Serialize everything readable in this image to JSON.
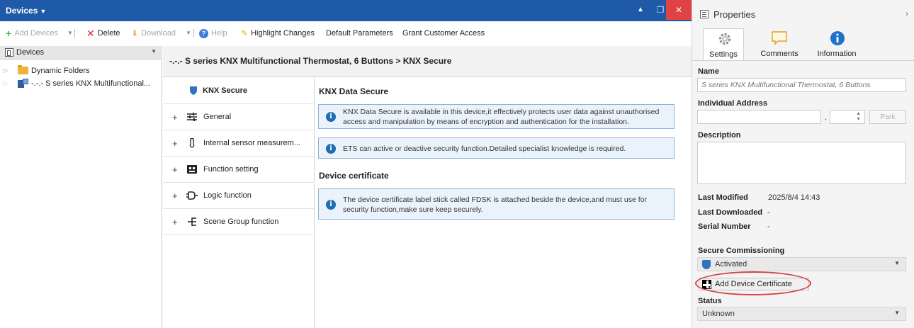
{
  "window": {
    "title": "Devices"
  },
  "toolbar": {
    "add_devices": "Add Devices",
    "delete": "Delete",
    "download": "Download",
    "help": "Help",
    "highlight_changes": "Highlight Changes",
    "default_parameters": "Default Parameters",
    "grant_customer_access": "Grant Customer Access"
  },
  "tree": {
    "header": "Devices",
    "items": [
      {
        "label": "Dynamic Folders",
        "icon": "folder-icon"
      },
      {
        "label": "-.-.- S series KNX Multifunctional...",
        "icon": "device-icon"
      }
    ]
  },
  "breadcrumb": "-.-.- S series KNX Multifunctional Thermostat, 6 Buttons > KNX Secure",
  "param_tree": [
    {
      "label": "KNX Secure",
      "icon": "shield-icon",
      "selected": true
    },
    {
      "label": "General",
      "icon": "sliders-icon"
    },
    {
      "label": "Internal sensor measurem...",
      "icon": "sensor-icon"
    },
    {
      "label": "Function setting",
      "icon": "function-icon"
    },
    {
      "label": "Logic function",
      "icon": "logic-icon"
    },
    {
      "label": "Scene Group function",
      "icon": "scene-icon"
    }
  ],
  "pane": {
    "section1": "KNX Data Secure",
    "info1": "KNX Data Secure is available in this device,it effectively protects user data against unauthorised access and manipulation by means of encryption and authentication for the installation.",
    "info2": "ETS can active or deactive security function.Detailed specialist knowledge is required.",
    "section2": "Device certificate",
    "info3": "The device certificate label stick called FDSK is attached beside the device,and must use for security function,make sure keep securely."
  },
  "properties": {
    "title": "Properties",
    "tabs": [
      "Settings",
      "Comments",
      "Information"
    ],
    "name_label": "Name",
    "name_value": "S series KNX Multifunctional Thermostat, 6 Buttons",
    "address_label": "Individual Address",
    "park_label": "Park",
    "description_label": "Description",
    "last_modified_label": "Last Modified",
    "last_modified_value": "2025/8/4 14:43",
    "last_downloaded_label": "Last Downloaded",
    "last_downloaded_value": "-",
    "serial_label": "Serial Number",
    "serial_value": "-",
    "secure_label": "Secure Commissioning",
    "secure_value": "Activated",
    "add_cert": "Add Device Certificate",
    "status_label": "Status",
    "status_value": "Unknown"
  },
  "colors": {
    "titlebar": "#1f5aa8",
    "close": "#e04343",
    "info_bg": "#eaf3fb",
    "info_icon": "#1f6cb4",
    "callout": "#d64545"
  }
}
